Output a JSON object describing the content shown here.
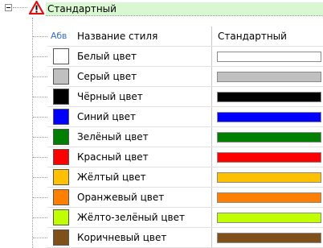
{
  "header": {
    "title": "Стандартный",
    "warning_icon": "warning-triangle-icon",
    "expander_icon": "minus-box-icon"
  },
  "name_row": {
    "icon_text": "Абв",
    "label": "Название стиля",
    "value": "Стандартный"
  },
  "colors": [
    {
      "label": "Белый цвет",
      "color": "#ffffff"
    },
    {
      "label": "Серый цвет",
      "color": "#c0c0c0"
    },
    {
      "label": "Чёрный цвет",
      "color": "#000000"
    },
    {
      "label": "Синий цвет",
      "color": "#0000ff"
    },
    {
      "label": "Зелёный цвет",
      "color": "#008000"
    },
    {
      "label": "Красный цвет",
      "color": "#ff0000"
    },
    {
      "label": "Жёлтый цвет",
      "color": "#ffc000"
    },
    {
      "label": "Оранжевый цвет",
      "color": "#ff8000"
    },
    {
      "label": "Жёлто-зелёный цвет",
      "color": "#c0ff00"
    },
    {
      "label": "Коричневый цвет",
      "color": "#80501a"
    }
  ]
}
